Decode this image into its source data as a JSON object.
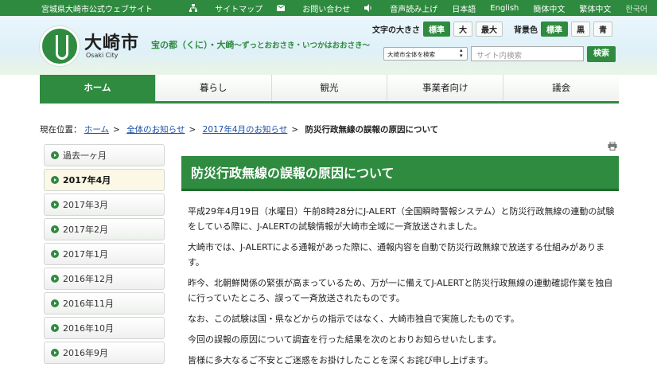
{
  "topbar": {
    "site_name": "宮城県大崎市公式ウェブサイト",
    "sitemap": "サイトマップ",
    "contact": "お問い合わせ",
    "voice": "音声読み上げ",
    "lang_ja": "日本語",
    "lang_en": "English",
    "lang_zh_cn": "簡体中文",
    "lang_zh_tw": "繁体中文",
    "lang_ko": "한국어"
  },
  "header": {
    "city_name": "大崎市",
    "city_name_en": "Osaki City",
    "catch_main": "宝の都（くに）・大崎",
    "catch_sub": "～ずっとおおさき・いつかはおおさき～",
    "font_size_label": "文字の大きさ",
    "font_size_options": [
      "標準",
      "大",
      "最大"
    ],
    "bg_color_label": "背景色",
    "bg_color_options": [
      "標準",
      "黒",
      "青"
    ],
    "search_scope": "大崎市全体を検索",
    "search_placeholder": "サイト内検索",
    "search_button": "検索"
  },
  "nav": [
    "ホーム",
    "暮らし",
    "観光",
    "事業者向け",
    "議会"
  ],
  "breadcrumb": {
    "label": "現在位置：",
    "links": [
      "ホーム",
      "全体のお知らせ",
      "2017年4月のお知らせ"
    ],
    "current": "防災行政無線の誤報の原因について"
  },
  "sidebar": [
    "過去一ヶ月",
    "2017年4月",
    "2017年3月",
    "2017年2月",
    "2017年1月",
    "2016年12月",
    "2016年11月",
    "2016年10月",
    "2016年9月"
  ],
  "article": {
    "title": "防災行政無線の誤報の原因について",
    "paragraphs": [
      "平成29年4月19日（水曜日）午前8時28分にJ-ALERT（全国瞬時警報システム）と防災行政無線の連動の試験をしている際に、J-ALERTの試験情報が大崎市全域に一斉放送されました。",
      "大崎市では、J-ALERTによる通報があった際に、通報内容を自動で防災行政無線で放送する仕組みがあります。",
      "昨今、北朝鮮関係の緊張が高まっているため、万が一に備えてJ-ALERTと防災行政無線の連動確認作業を独自に行っていたところ、誤って一斉放送されたものです。",
      "なお、この試験は国・県などからの指示ではなく、大崎市独自で実施したものです。",
      "今回の誤報の原因について調査を行った結果を次のとおりお知らせいたします。",
      "皆様に多大なるご不安とご迷惑をお掛けしたことを深くお詫び申し上げます。"
    ]
  },
  "colors": {
    "accent": "#2e8b3f",
    "link": "#1a4fa8",
    "current_bg": "#fbf8e6"
  }
}
